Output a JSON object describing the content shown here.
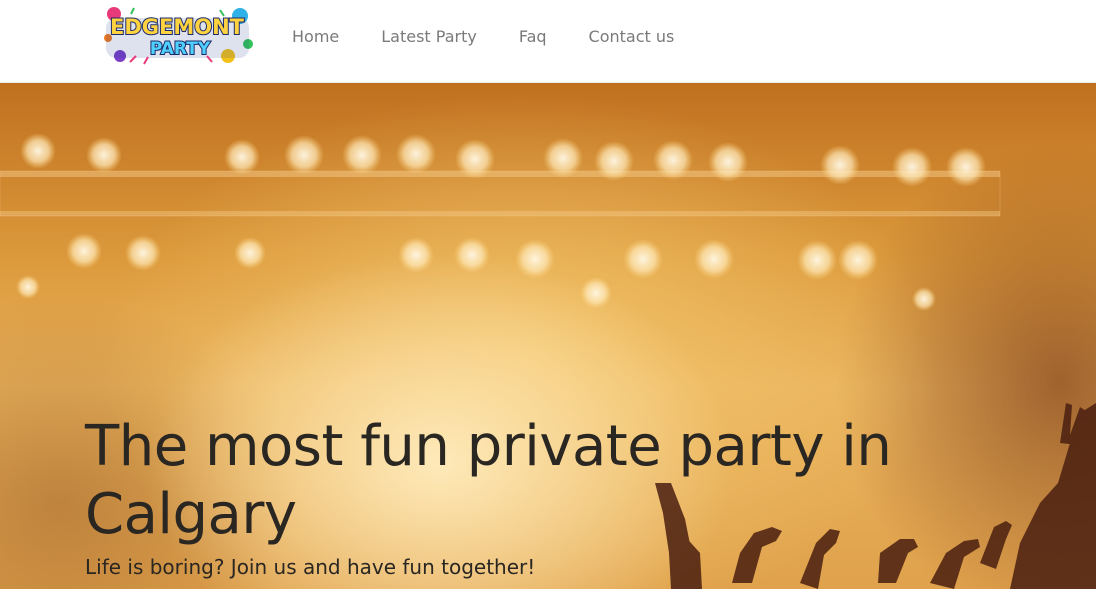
{
  "logo": {
    "line1": "EDGEMONT",
    "line2": "PARTY"
  },
  "nav": {
    "items": [
      {
        "label": "Home"
      },
      {
        "label": "Latest Party"
      },
      {
        "label": "Faq"
      },
      {
        "label": "Contact us"
      }
    ]
  },
  "hero": {
    "headline": "The most fun private party in Calgary",
    "subheadline": "Life is boring? Join us and have fun together!"
  }
}
